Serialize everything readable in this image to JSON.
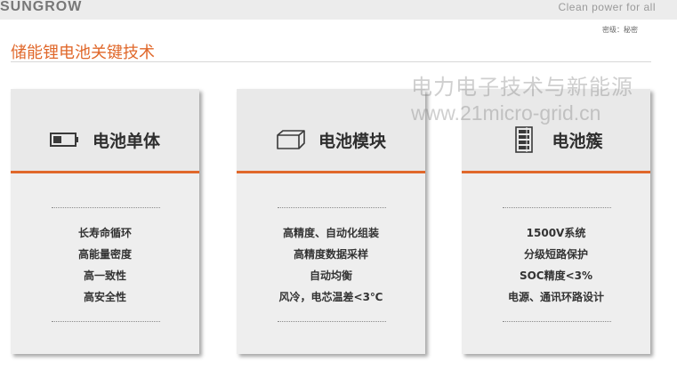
{
  "header": {
    "logo": "SUNGROW",
    "slogan": "Clean power for all",
    "classification": "密级：秘密"
  },
  "page": {
    "title": "储能锂电池关键技术"
  },
  "watermark": {
    "cn": "电力电子技术与新能源",
    "url": "www.21micro-grid.cn"
  },
  "colors": {
    "accent": "#e0682b",
    "card_bg": "#eeeeee",
    "text_dark": "#2e2e2e"
  },
  "cards": [
    {
      "icon": "battery-cell-icon",
      "title": "电池单体",
      "features": [
        "长寿命循环",
        "高能量密度",
        "高一致性",
        "高安全性"
      ]
    },
    {
      "icon": "battery-module-icon",
      "title": "电池模块",
      "features": [
        "高精度、自动化组装",
        "高精度数据采样",
        "自动均衡",
        "风冷，电芯温差<3℃"
      ]
    },
    {
      "icon": "battery-cluster-icon",
      "title": "电池簇",
      "features": [
        "1500V系统",
        "分级短路保护",
        "SOC精度<3%",
        "电源、通讯环路设计"
      ]
    }
  ]
}
